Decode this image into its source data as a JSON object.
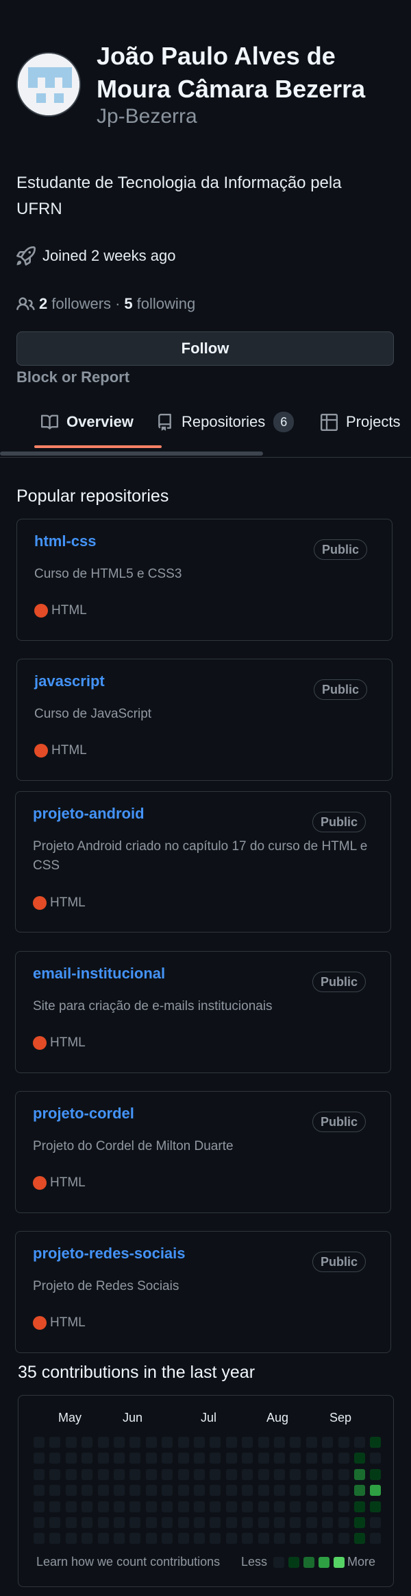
{
  "profile": {
    "full_name": "João Paulo Alves de Moura Câmara Bezerra",
    "username": "Jp-Bezerra",
    "bio": "Estudante de Tecnologia da Informação pela UFRN",
    "joined": "Joined 2 weeks ago",
    "followers_count": "2",
    "followers_label": "followers",
    "separator": "·",
    "following_count": "5",
    "following_label": "following",
    "follow_button": "Follow",
    "block_report": "Block or Report"
  },
  "tabs": [
    {
      "label": "Overview",
      "icon": "book-icon",
      "active": true
    },
    {
      "label": "Repositories",
      "icon": "repo-icon",
      "count": "6"
    },
    {
      "label": "Projects",
      "icon": "table-icon"
    }
  ],
  "popular": {
    "title": "Popular repositories",
    "repos": [
      {
        "name": "html-css",
        "visibility": "Public",
        "description": "Curso de HTML5 e CSS3",
        "language": "HTML"
      },
      {
        "name": "javascript",
        "visibility": "Public",
        "description": "Curso de JavaScript",
        "language": "HTML"
      },
      {
        "name": "projeto-android",
        "visibility": "Public",
        "description": "Projeto Android criado no capítulo 17 do curso de HTML e CSS",
        "language": "HTML"
      },
      {
        "name": "email-institucional",
        "visibility": "Public",
        "description": "Site para criação de e-mails institucionais",
        "language": "HTML"
      },
      {
        "name": "projeto-cordel",
        "visibility": "Public",
        "description": "Projeto do Cordel de Milton Duarte",
        "language": "HTML"
      },
      {
        "name": "projeto-redes-sociais",
        "visibility": "Public",
        "description": "Projeto de Redes Sociais",
        "language": "HTML"
      }
    ]
  },
  "contributions": {
    "title": "35 contributions in the last year",
    "months": [
      "May",
      "Jun",
      "Jul",
      "Aug",
      "Sep"
    ],
    "learn_link": "Learn how we count contributions",
    "legend_less": "Less",
    "legend_more": "More",
    "level_colors": [
      "#151b23",
      "#033a16",
      "#196c2e",
      "#2ea043",
      "#56d364"
    ],
    "last_weeks_levels": [
      [
        0,
        1,
        2,
        2,
        1,
        1,
        1
      ],
      [
        1,
        0,
        1,
        3,
        1,
        0,
        0
      ]
    ]
  },
  "colors": {
    "accent_link": "#4493f8",
    "tab_underline": "#f78166",
    "html_language": "#e34c26"
  }
}
